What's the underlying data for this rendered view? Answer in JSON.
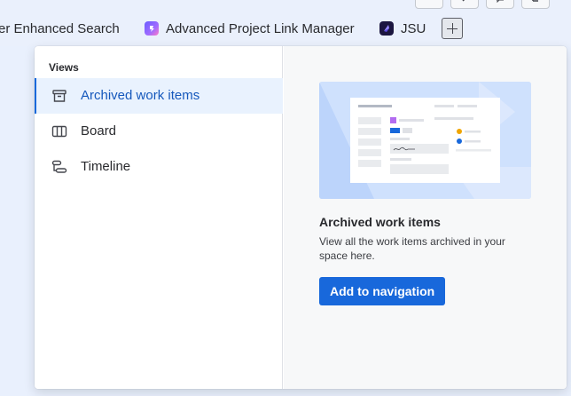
{
  "topbar": {
    "tabs": [
      {
        "label": "er Enhanced Search",
        "icon": "none"
      },
      {
        "label": "Advanced Project Link Manager",
        "icon": "link-manager-app-icon"
      },
      {
        "label": "JSU",
        "icon": "jsu-app-icon"
      }
    ],
    "add_tab_icon": "plus-icon"
  },
  "popup": {
    "views_heading": "Views",
    "views": [
      {
        "label": "Archived work items",
        "icon": "archive-icon",
        "selected": true
      },
      {
        "label": "Board",
        "icon": "board-icon",
        "selected": false
      },
      {
        "label": "Timeline",
        "icon": "timeline-icon",
        "selected": false
      }
    ],
    "detail": {
      "title": "Archived work items",
      "description": "View all the work items archived in your space here.",
      "button_label": "Add to navigation"
    }
  },
  "colors": {
    "accent": "#1868db",
    "selected_bg": "#e9f2fe",
    "app_background": "#e9f0fd"
  }
}
